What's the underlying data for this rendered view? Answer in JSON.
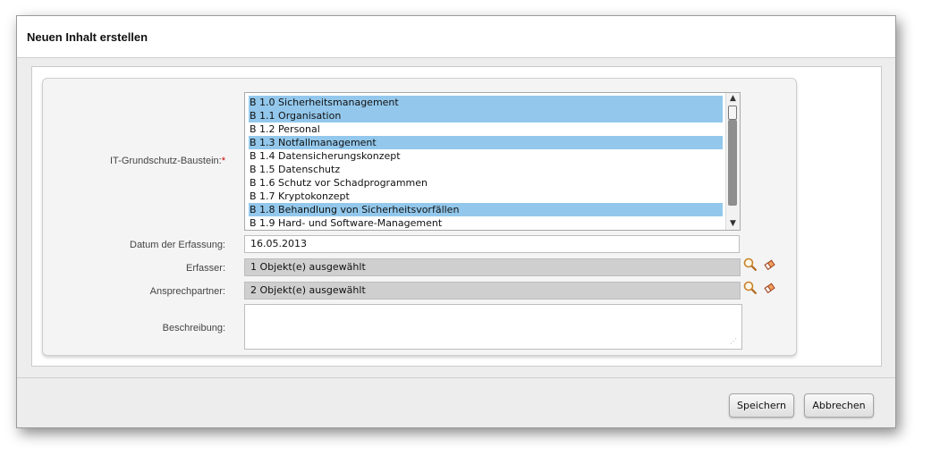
{
  "dialog": {
    "title": "Neuen Inhalt erstellen"
  },
  "form": {
    "baustein_label": "IT-Grundschutz-Baustein:",
    "required_mark": "*",
    "baustein_options": [
      {
        "label": "B 1.0 Sicherheitsmanagement",
        "selected": true
      },
      {
        "label": "B 1.1 Organisation",
        "selected": true
      },
      {
        "label": "B 1.2 Personal",
        "selected": false
      },
      {
        "label": "B 1.3 Notfallmanagement",
        "selected": true
      },
      {
        "label": "B 1.4 Datensicherungskonzept",
        "selected": false
      },
      {
        "label": "B 1.5 Datenschutz",
        "selected": false
      },
      {
        "label": "B 1.6 Schutz vor Schadprogrammen",
        "selected": false
      },
      {
        "label": "B 1.7 Kryptokonzept",
        "selected": false
      },
      {
        "label": "B 1.8 Behandlung von Sicherheitsvorfällen",
        "selected": true
      },
      {
        "label": "B 1.9 Hard- und Software-Management",
        "selected": false
      }
    ],
    "datum_label": "Datum der Erfassung:",
    "datum_value": "16.05.2013",
    "erfasser_label": "Erfasser:",
    "erfasser_value": "1 Objekt(e) ausgewählt",
    "ansprechpartner_label": "Ansprechpartner:",
    "ansprechpartner_value": "2 Objekt(e) ausgewählt",
    "beschreibung_label": "Beschreibung:",
    "beschreibung_value": ""
  },
  "icons": {
    "search": "magnifier-icon",
    "clear": "eraser-icon",
    "scroll_up": "▲",
    "scroll_down": "▼"
  },
  "buttons": {
    "save": "Speichern",
    "cancel": "Abbrechen"
  },
  "colors": {
    "selection": "#93c8ec",
    "readonly_field": "#cfcfcf",
    "required": "#cc0000"
  }
}
